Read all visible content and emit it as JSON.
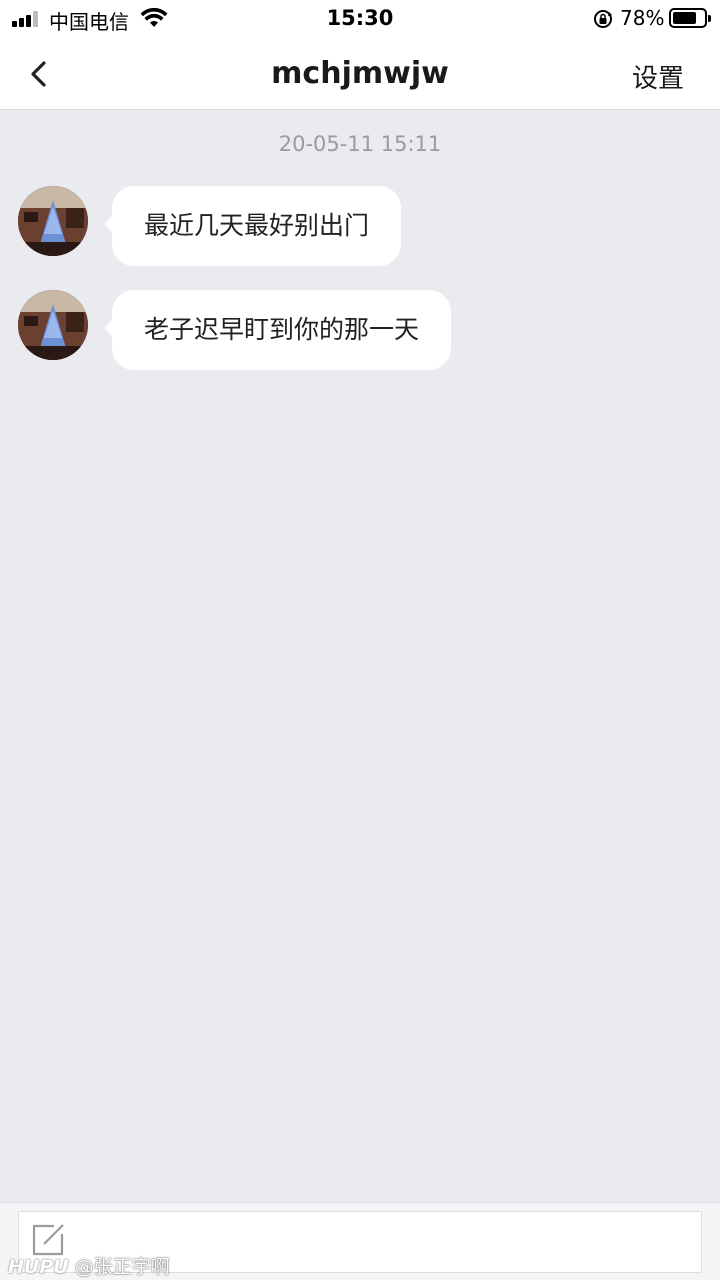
{
  "status_bar": {
    "carrier": "中国电信",
    "time": "15:30",
    "battery_percent": "78%",
    "battery_level": 0.78
  },
  "nav": {
    "title": "mchjmwjw",
    "settings_label": "设置"
  },
  "chat": {
    "timestamp": "20-05-11 15:11",
    "messages": [
      {
        "text": "最近几天最好别出门"
      },
      {
        "text": "老子迟早盯到你的那一天"
      }
    ]
  },
  "watermark": {
    "brand": "HUPU",
    "handle": "@张正宇啊"
  },
  "colors": {
    "background": "#eaebee",
    "bubble": "#ffffff",
    "timestamp": "#9a9ba0"
  }
}
